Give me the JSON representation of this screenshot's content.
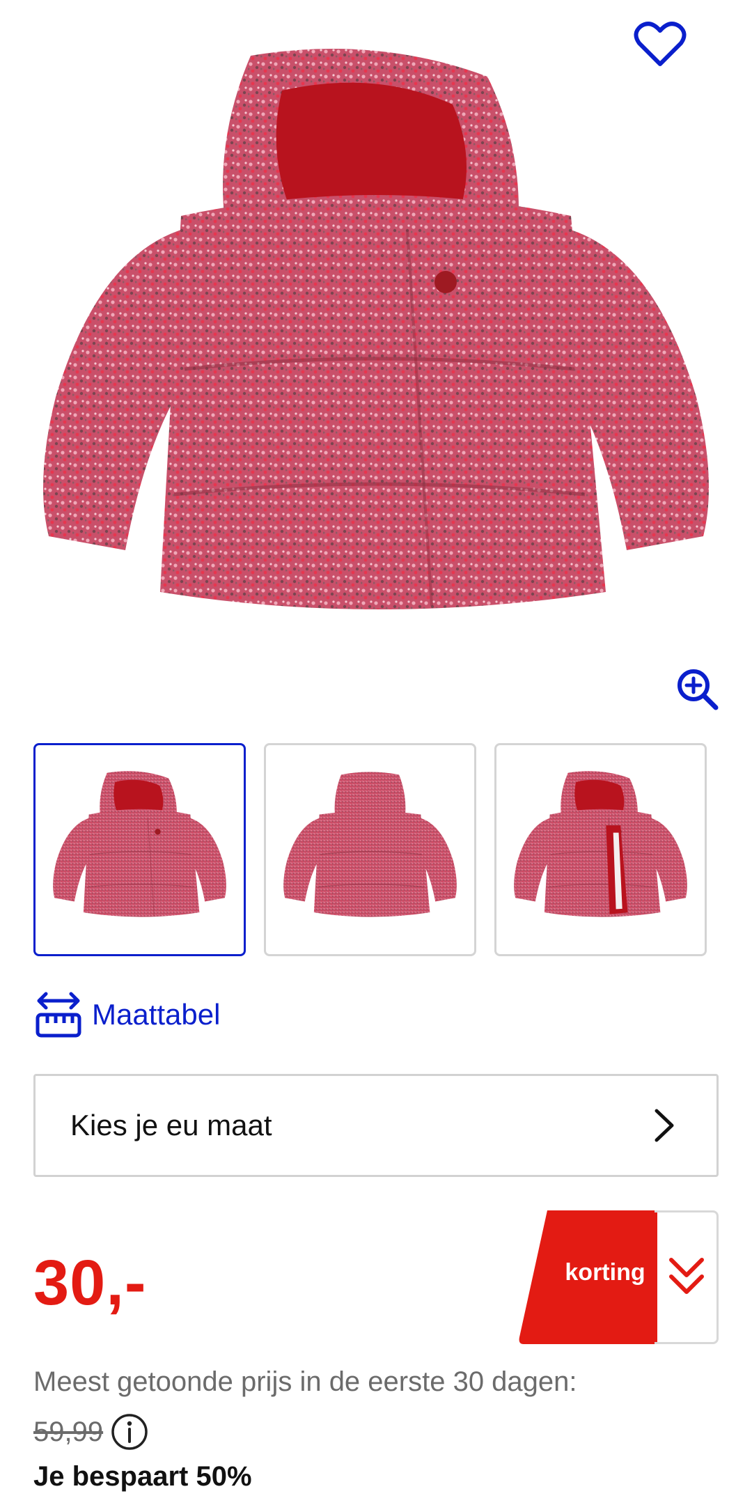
{
  "product": {
    "main_image_alt": "Roze gebloemde winterjas met capuchon",
    "favorite_icon": "heart-outline-icon",
    "zoom_icon": "zoom-in-icon",
    "thumbnails": [
      {
        "view": "front",
        "selected": true
      },
      {
        "view": "back",
        "selected": false
      },
      {
        "view": "open",
        "selected": false
      }
    ]
  },
  "size_chart": {
    "label": "Maattabel",
    "icon": "ruler-arrows-icon"
  },
  "size_select": {
    "label": "Kies je eu maat",
    "icon": "chevron-right-icon"
  },
  "price": {
    "current": "30,-",
    "badge_label": "korting",
    "badge_icon": "double-chevron-down-icon",
    "lowest_price_note": "Meest getoonde prijs in de eerste 30 dagen:",
    "old_price": "59,99",
    "info_icon": "info-icon",
    "savings": "Je bespaart 50%"
  },
  "colors": {
    "accent_blue": "#0a1fcc",
    "price_red": "#e31b13",
    "muted_text": "#6b6b6b"
  }
}
